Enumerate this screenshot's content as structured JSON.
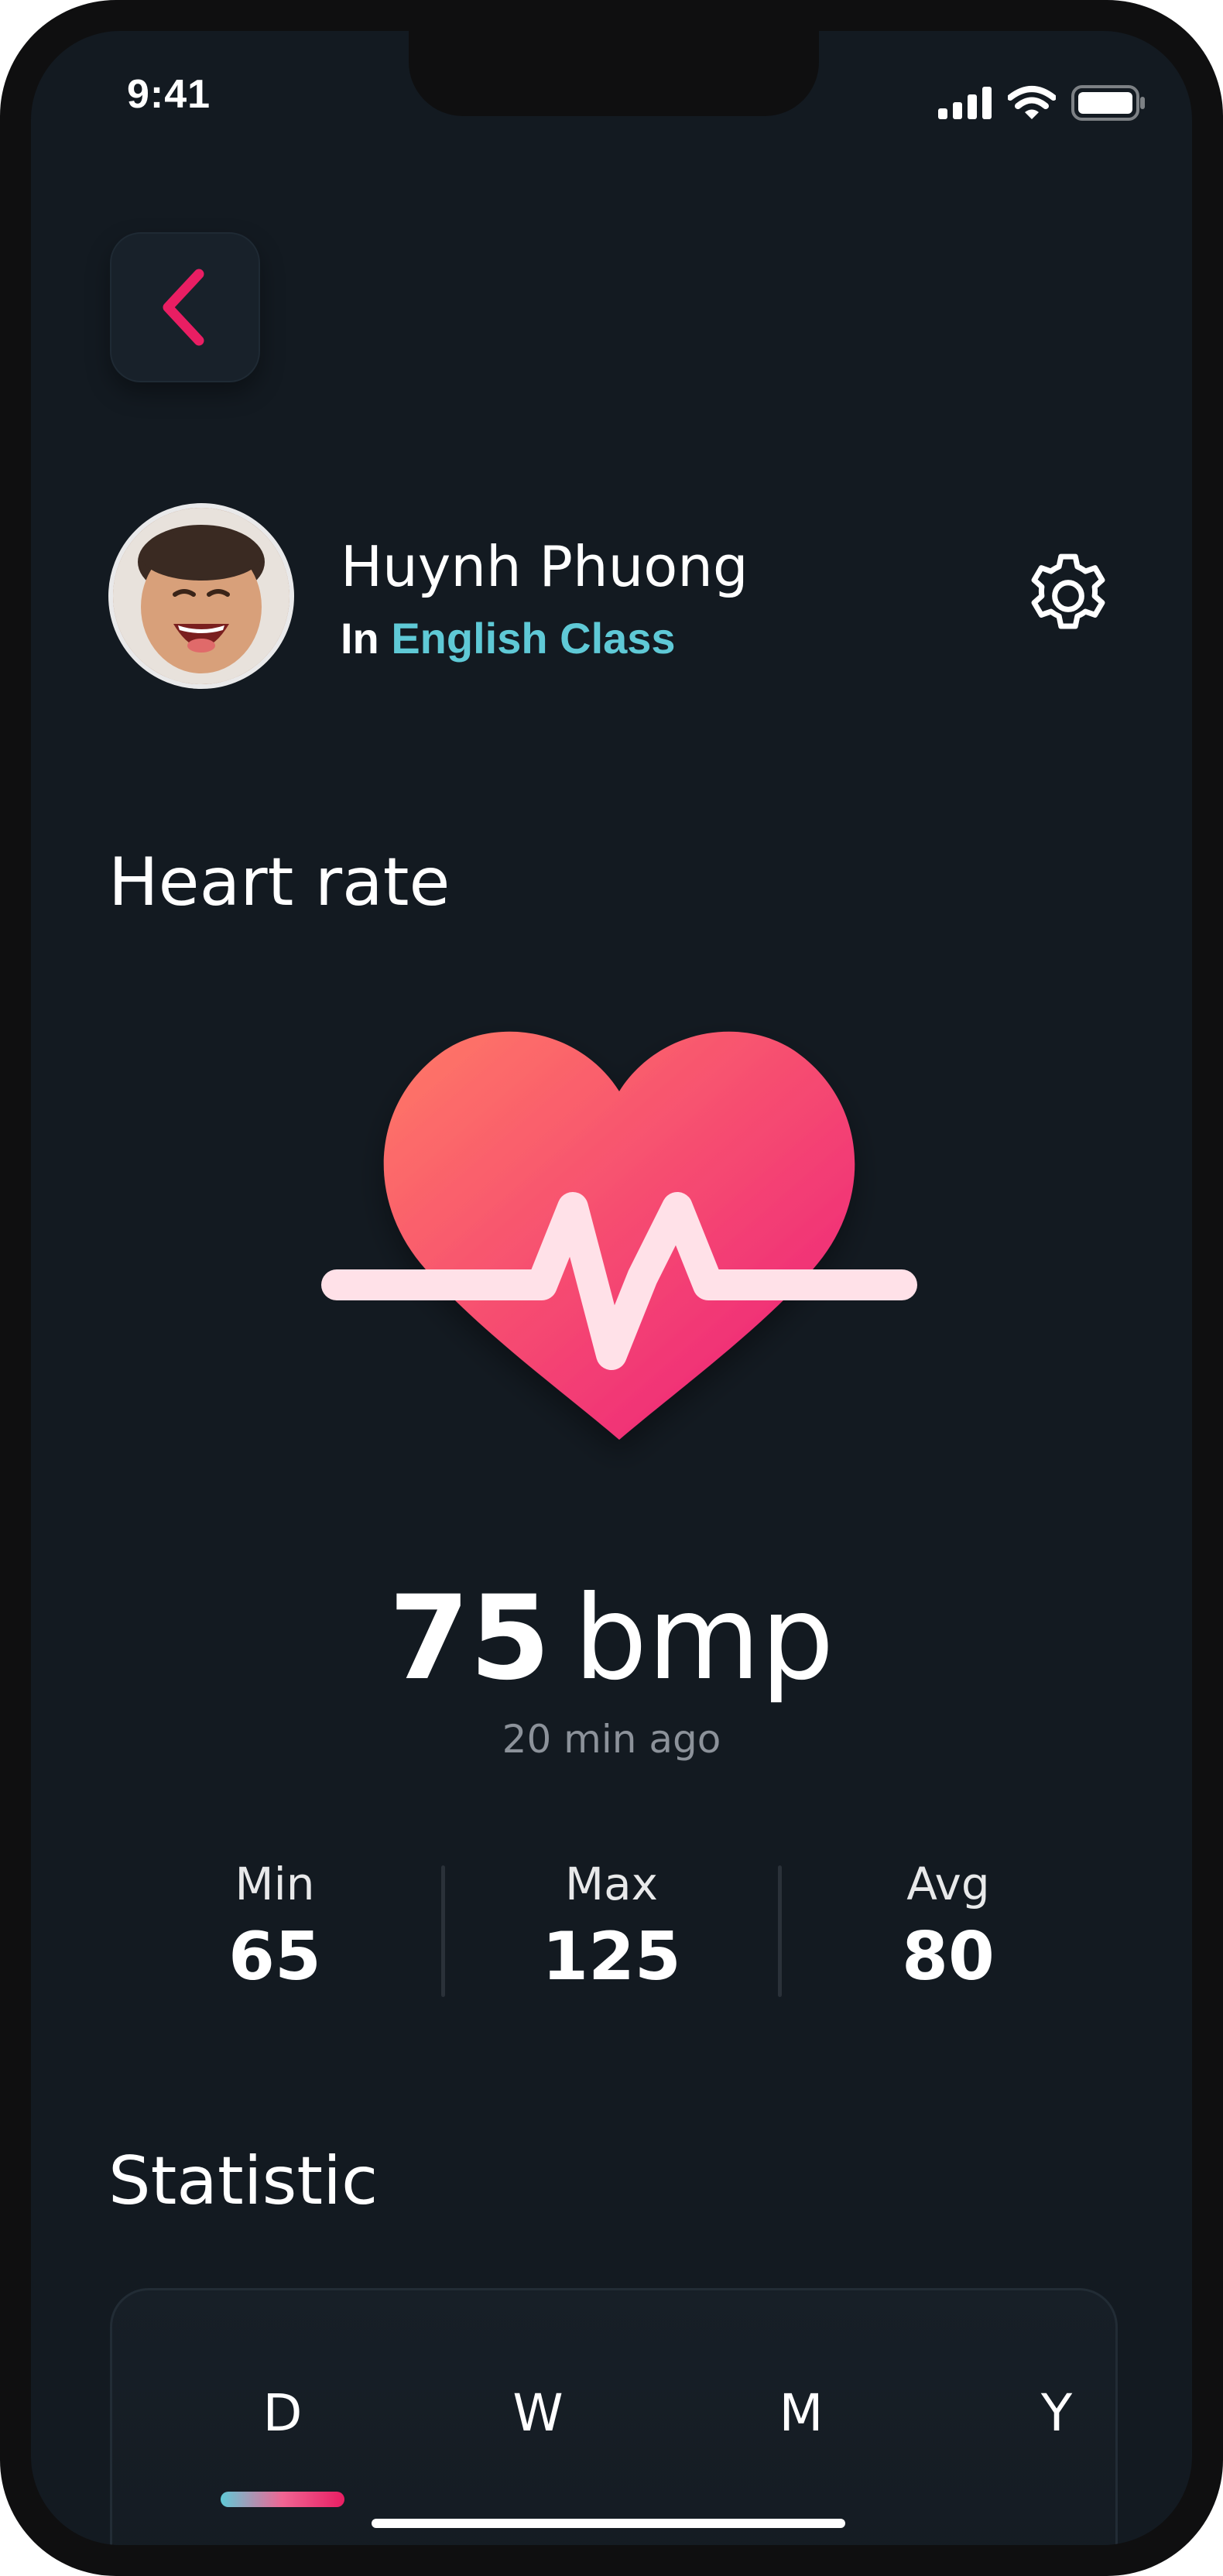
{
  "status_bar": {
    "time": "9:41"
  },
  "user": {
    "name": "Huynh Phuong",
    "class_prefix": "In",
    "class_name": "English Class"
  },
  "heart_rate": {
    "title": "Heart rate",
    "value": "75",
    "unit": "bmp",
    "updated": "20 min ago",
    "stats": [
      {
        "label": "Min",
        "value": "65"
      },
      {
        "label": "Max",
        "value": "125"
      },
      {
        "label": "Avg",
        "value": "80"
      }
    ]
  },
  "statistic": {
    "title": "Statistic",
    "periods": [
      "D",
      "W",
      "M",
      "Y"
    ],
    "selected_period": "D"
  },
  "colors": {
    "background": "#131a21",
    "accent_pink": "#e91e63",
    "accent_cyan": "#5fc9d6",
    "heart_gradient_start": "#ff7a66",
    "heart_gradient_end": "#ec1b7c"
  },
  "icons": {
    "back": "chevron-left-icon",
    "settings": "gear-icon",
    "signal": "signal-icon",
    "wifi": "wifi-icon",
    "battery": "battery-icon"
  }
}
